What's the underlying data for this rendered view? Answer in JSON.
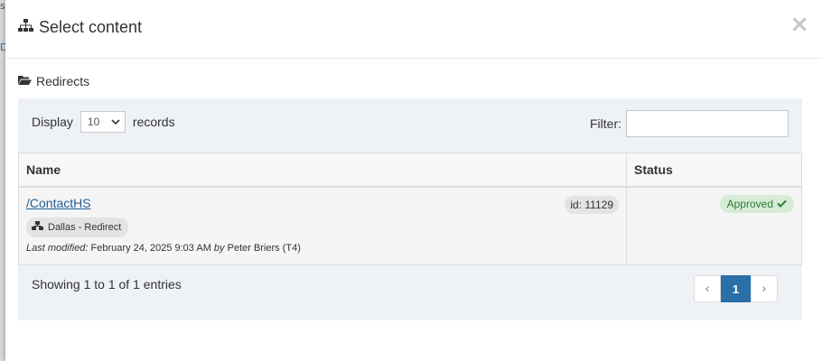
{
  "modal": {
    "title": "Select content",
    "close_glyph": "×",
    "folder": "Redirects"
  },
  "toolbar": {
    "display_label": "Display",
    "display_value": "10",
    "records_label": "records",
    "filter_label": "Filter:",
    "filter_value": ""
  },
  "table": {
    "columns": [
      "Name",
      "Status"
    ],
    "rows": [
      {
        "name": "/ContactHS",
        "id": "id: 11129",
        "site": "Dallas - Redirect",
        "modified_label": "Last modified:",
        "modified_date": "February 24, 2025 9:03 AM",
        "by_label": "by",
        "modified_by": "Peter Briers (T4)",
        "status": "Approved"
      }
    ]
  },
  "footer": {
    "info": "Showing 1 to 1 of 1 entries",
    "prev": "‹",
    "page": "1",
    "next": "›"
  },
  "colors": {
    "accent": "#2a6fa8",
    "link": "#1f5f95",
    "approved_bg": "#d7ebd7",
    "approved_text": "#2f7d32",
    "panel_bg": "#eef1f5"
  },
  "icons": {
    "title": "sitemap-icon",
    "folder": "folder-open-icon",
    "site": "sitemap-icon",
    "status": "check-icon",
    "close": "close-icon"
  }
}
